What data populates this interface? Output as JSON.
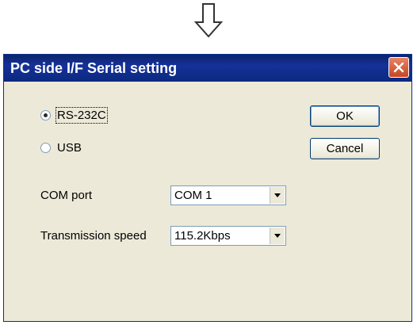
{
  "dialog": {
    "title": "PC side I/F  Serial setting",
    "connection": {
      "options": [
        {
          "label": "RS-232C",
          "selected": true
        },
        {
          "label": "USB",
          "selected": false
        }
      ]
    },
    "buttons": {
      "ok_label": "OK",
      "cancel_label": "Cancel"
    },
    "com_port": {
      "label": "COM port",
      "value": "COM 1"
    },
    "transmission_speed": {
      "label": "Transmission speed",
      "value": "115.2Kbps"
    }
  },
  "colors": {
    "titlebar": "#0a246a",
    "dialog_bg": "#ece9d8",
    "close_button": "#c54620"
  },
  "icons": [
    "down-arrow-icon",
    "close-icon",
    "chevron-down-icon"
  ]
}
